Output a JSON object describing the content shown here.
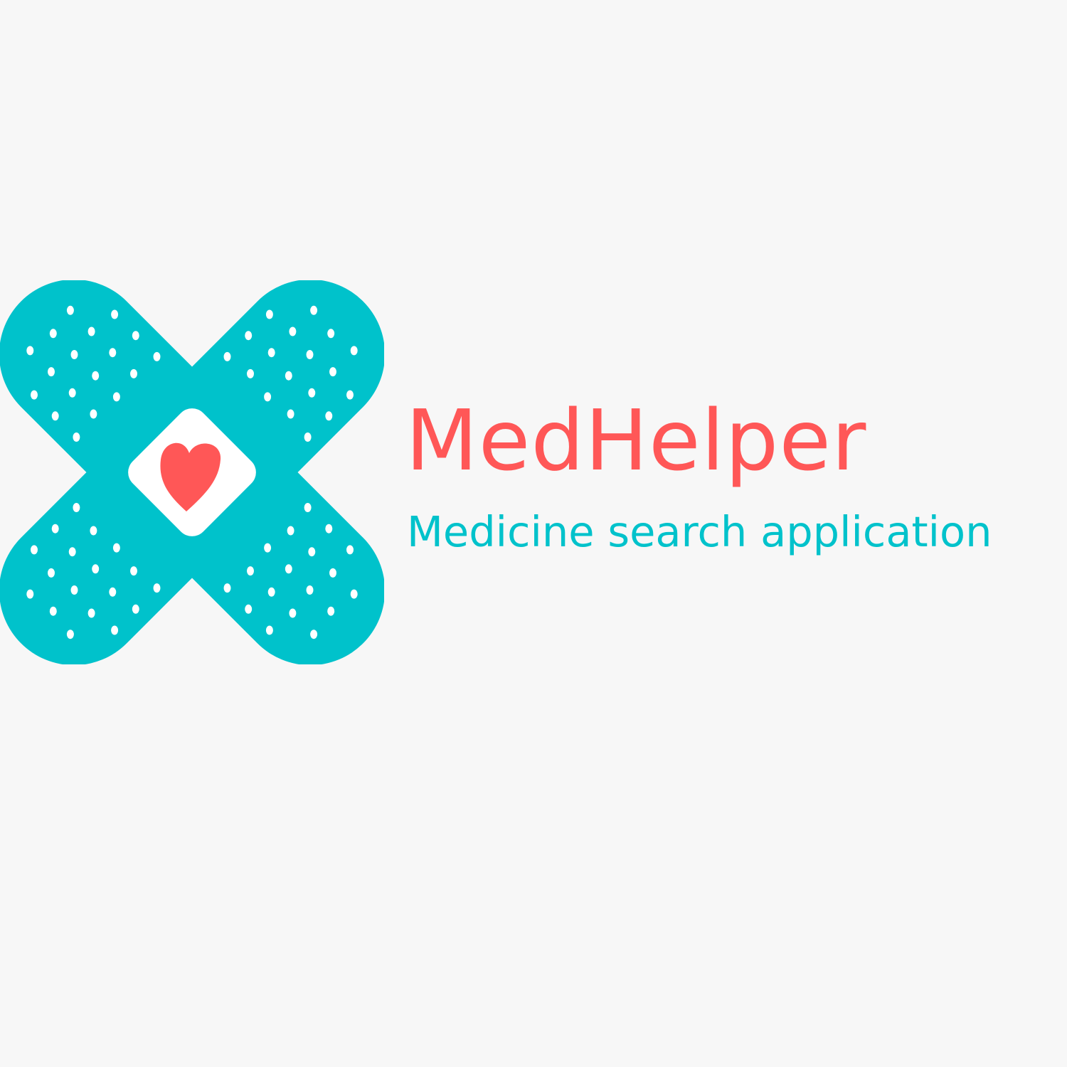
{
  "brand": {
    "name": "MedHelper",
    "tagline": "Medicine search application"
  },
  "colors": {
    "background": "#f7f7f7",
    "bandage": "#00c2cb",
    "heart": "#ff5757",
    "pad": "#ffffff",
    "dots": "#ffffff"
  },
  "icons": {
    "logo": "crossed-bandages-icon",
    "center": "heart-icon"
  }
}
